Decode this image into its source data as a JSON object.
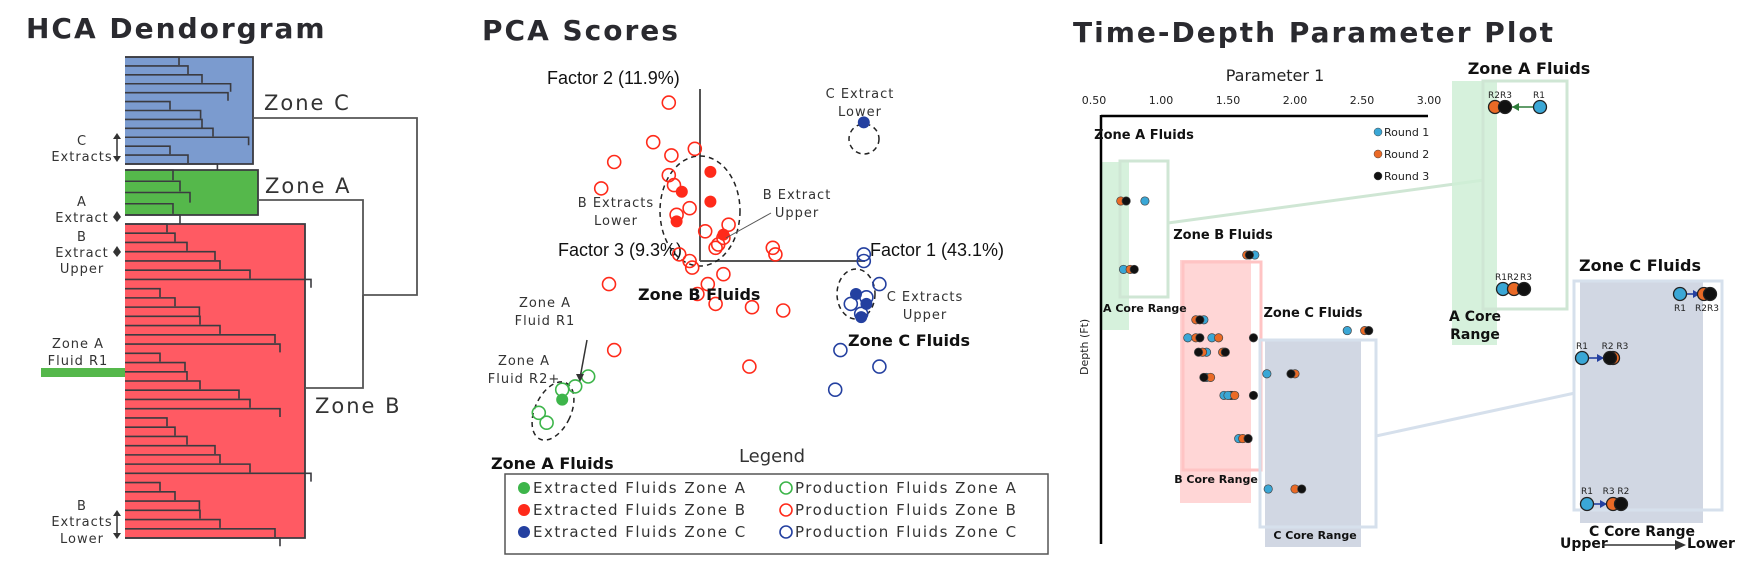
{
  "hca": {
    "title": "HCA Dendorgram",
    "zones": [
      {
        "label": "Zone C",
        "color": "#7b9bcf"
      },
      {
        "label": "Zone A",
        "color": "#55b84b"
      },
      {
        "label": "Zone B",
        "color": "#ff5a63"
      }
    ],
    "annotations": {
      "c_extracts": [
        "C",
        "Extracts"
      ],
      "a_extract": [
        "A",
        "Extract"
      ],
      "b_extract_upper": [
        "B",
        "Extract",
        "Upper"
      ],
      "zone_a_fluid_r1": [
        "Zone A",
        "Fluid R1"
      ],
      "b_extracts_lower": [
        "B",
        "Extracts",
        "Lower"
      ]
    },
    "leaf_counts": {
      "zone_c": 12,
      "zone_a": 4,
      "zone_b": 34
    }
  },
  "chart_data": [
    {
      "type": "scatter",
      "title": "PCA Scores",
      "xlabel": "Factor 1 (43.1%)",
      "ylabel": "Factor 2 (11.9%)",
      "zlabel": "Factor 3 (9.3%)",
      "series": [
        {
          "name": "Extracted Fluids Zone A",
          "color": "#3db54a",
          "filled": true,
          "points": [
            [
              -5.3,
              -4.2
            ]
          ]
        },
        {
          "name": "Production Fluids Zone A",
          "color": "#3db54a",
          "filled": false,
          "points": [
            [
              -4.3,
              -3.5
            ],
            [
              -4.8,
              -3.8
            ],
            [
              -5.3,
              -3.9
            ],
            [
              -6.2,
              -4.6
            ],
            [
              -5.9,
              -4.9
            ]
          ]
        },
        {
          "name": "Extracted Fluids Zone B",
          "color": "#ff2a1a",
          "filled": true,
          "points": [
            [
              0.4,
              2.7
            ],
            [
              -0.7,
              2.1
            ],
            [
              0.4,
              1.8
            ],
            [
              -0.9,
              1.2
            ],
            [
              0.9,
              0.8
            ]
          ]
        },
        {
          "name": "Production Fluids Zone B",
          "color": "#ff2a1a",
          "filled": false,
          "points": [
            [
              -1.2,
              4.8
            ],
            [
              -1.8,
              3.6
            ],
            [
              -0.2,
              3.4
            ],
            [
              -1.1,
              3.2
            ],
            [
              -3.3,
              3.0
            ],
            [
              -1.2,
              2.6
            ],
            [
              -1.0,
              2.3
            ],
            [
              -3.8,
              2.2
            ],
            [
              -0.4,
              1.6
            ],
            [
              -0.9,
              1.4
            ],
            [
              0.2,
              0.9
            ],
            [
              1.1,
              1.1
            ],
            [
              0.9,
              0.7
            ],
            [
              0.7,
              0.5
            ],
            [
              -0.8,
              0.2
            ],
            [
              -0.4,
              0.0
            ],
            [
              0.6,
              0.4
            ],
            [
              2.8,
              0.4
            ],
            [
              2.9,
              0.2
            ],
            [
              -0.3,
              -0.2
            ],
            [
              0.9,
              -0.4
            ],
            [
              -3.5,
              -0.7
            ],
            [
              0.3,
              -0.7
            ],
            [
              -0.1,
              -1.0
            ],
            [
              0.6,
              -1.3
            ],
            [
              2.0,
              -1.4
            ],
            [
              3.2,
              -1.5
            ],
            [
              -3.3,
              -2.7
            ],
            [
              1.9,
              -3.2
            ]
          ]
        },
        {
          "name": "Extracted Fluids Zone C",
          "color": "#2440a0",
          "filled": true,
          "points": [
            [
              6.3,
              4.2
            ],
            [
              6.0,
              -1.0
            ],
            [
              6.4,
              -1.3
            ],
            [
              6.2,
              -1.7
            ]
          ]
        },
        {
          "name": "Production Fluids Zone C",
          "color": "#2440a0",
          "filled": false,
          "points": [
            [
              6.3,
              0.2
            ],
            [
              6.3,
              0.0
            ],
            [
              6.9,
              -0.7
            ],
            [
              5.8,
              -1.3
            ],
            [
              6.4,
              -1.1
            ],
            [
              6.2,
              -1.6
            ],
            [
              5.4,
              -2.7
            ],
            [
              6.9,
              -3.2
            ],
            [
              5.2,
              -3.9
            ]
          ]
        }
      ],
      "annotations": [
        {
          "text": [
            "C Extract",
            "Lower"
          ]
        },
        {
          "text": [
            "B Extract",
            "Upper"
          ]
        },
        {
          "text": [
            "B Extracts",
            "Lower"
          ]
        },
        {
          "text": [
            "C Extracts",
            "Upper"
          ]
        },
        {
          "text": [
            "Zone A",
            "Fluid R1"
          ]
        },
        {
          "text": [
            "Zone A",
            "Fluid R2+"
          ]
        }
      ],
      "group_labels": [
        "Zone B Fluids",
        "Zone C Fluids",
        "Zone A Fluids"
      ],
      "legend_title": "Legend",
      "legend_position": "bottom"
    },
    {
      "type": "scatter",
      "title": "Time-Depth Parameter Plot",
      "xlabel": "Parameter 1",
      "ylabel": "Depth (Ft)",
      "xlim": [
        0.5,
        3.0
      ],
      "xticks": [
        "0.50",
        "1.00",
        "1.50",
        "2.00",
        "2.50",
        "3.00"
      ],
      "legend": [
        {
          "name": "Round 1",
          "color": "#3aa7d6"
        },
        {
          "name": "Round 2",
          "color": "#ea6a26"
        },
        {
          "name": "Round 3",
          "color": "#111111"
        }
      ],
      "legend_position": "top-right",
      "zones": [
        {
          "name": "Zone A Fluids",
          "core_label": "A Core Range",
          "color": "#cfeed6"
        },
        {
          "name": "Zone B Fluids",
          "core_label": "B Core Range",
          "color": "#ffd2d2"
        },
        {
          "name": "Zone C Fluids",
          "core_label": "C Core Range",
          "color": "#ccd3e0"
        }
      ],
      "samples": [
        {
          "zone": "A",
          "depth": 0.1,
          "r1": 0.88,
          "r2": 0.7,
          "r3": 0.74
        },
        {
          "zone": "A",
          "depth": 0.29,
          "r1": 0.72,
          "r2": 0.77,
          "r3": 0.8
        },
        {
          "zone": "B",
          "depth": 0.25,
          "r1": 1.7,
          "r2": 1.64,
          "r3": 1.66
        },
        {
          "zone": "B",
          "depth": 0.43,
          "r1": 1.32,
          "r2": 1.26,
          "r3": 1.29
        },
        {
          "zone": "B",
          "depth": 0.48,
          "r1": 1.2,
          "r2": 1.26,
          "r3": 1.29
        },
        {
          "zone": "B",
          "depth": 0.48,
          "r1": 1.38,
          "r2": 1.43,
          "r3": 1.69
        },
        {
          "zone": "B",
          "depth": 0.52,
          "r1": 1.34,
          "r2": 1.31,
          "r3": 1.28
        },
        {
          "zone": "B",
          "depth": 0.52,
          "r1": 1.47,
          "r2": 1.46,
          "r3": 1.48
        },
        {
          "zone": "B",
          "depth": 0.59,
          "r1": 1.34,
          "r2": 1.37,
          "r3": 1.32
        },
        {
          "zone": "B",
          "depth": 0.64,
          "r1": 1.47,
          "r2": 1.53,
          "r3": 1.52
        },
        {
          "zone": "B",
          "depth": 0.64,
          "r1": 1.5,
          "r2": 1.55,
          "r3": 1.69
        },
        {
          "zone": "B",
          "depth": 0.76,
          "r1": 1.58,
          "r2": 1.61,
          "r3": 1.65
        },
        {
          "zone": "C",
          "depth": 0.46,
          "r1": 2.39,
          "r2": 2.52,
          "r3": 2.55
        },
        {
          "zone": "C",
          "depth": 0.58,
          "r1": 1.79,
          "r2": 2.0,
          "r3": 1.97
        },
        {
          "zone": "C",
          "depth": 0.9,
          "r1": 1.8,
          "r2": 2.0,
          "r3": 2.05
        }
      ],
      "insets": [
        {
          "title": "Zone A Fluids",
          "core_label": "A Core Range",
          "rows": [
            {
              "labels": [
                "R2",
                "R3",
                "R1"
              ],
              "arrow": "R1 → R2/R3"
            },
            {
              "labels": [
                "R1",
                "R2",
                "R3"
              ]
            }
          ]
        },
        {
          "title": "Zone C Fluids",
          "core_label": "C Core Range",
          "rows": [
            {
              "labels": [
                "R1",
                "R2R3"
              ],
              "arrow": "R1 → R2/R3"
            },
            {
              "labels": [
                "R1",
                "R2 R3"
              ],
              "arrow": "R1 → R2/R3"
            },
            {
              "labels": [
                "R1",
                "R3 R2"
              ],
              "arrow": "R1 → R3/R2"
            }
          ]
        }
      ],
      "direction_axis": {
        "from": "Upper",
        "to": "Lower"
      }
    }
  ],
  "colors": {
    "zone_a": "#3db54a",
    "zone_b": "#ff2a1a",
    "zone_c": "#2440a0",
    "round1": "#3aa7d6",
    "round2": "#ea6a26",
    "round3": "#111111"
  }
}
